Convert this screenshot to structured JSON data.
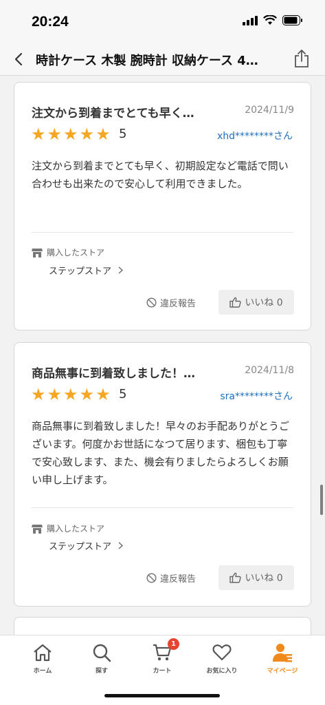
{
  "status": {
    "time": "20:24"
  },
  "nav": {
    "title": "時計ケース 木製 腕時計 収納ケース 4…"
  },
  "reviews": [
    {
      "title": "注文から到着までとても早く…",
      "date": "2024/11/9",
      "rating": "5",
      "stars": 5,
      "reviewer": "xhd********さん",
      "body": "注文から到着までとても早く、初期設定など電話で問い合わせも出来たので安心して利用できました。",
      "store_label": "購入したストア",
      "store_name": "ステップストア",
      "report_label": "違反報告",
      "like_label": "いいね 0"
    },
    {
      "title": "商品無事に到着致しました！…",
      "date": "2024/11/8",
      "rating": "5",
      "stars": 5,
      "reviewer": "sra********さん",
      "body": "商品無事に到着致しました！早々のお手配ありがとうございます。何度かお世話になつて居ります、梱包も丁寧で安心致します、また、機会有りましたらよろしくお願い申し上げます。",
      "store_label": "購入したストア",
      "store_name": "ステップストア",
      "report_label": "違反報告",
      "like_label": "いいね 0"
    }
  ],
  "tabs": [
    {
      "label": "ホーム",
      "icon": "home-icon"
    },
    {
      "label": "探す",
      "icon": "search-icon"
    },
    {
      "label": "カート",
      "icon": "cart-icon",
      "badge": "1"
    },
    {
      "label": "お気に入り",
      "icon": "heart-icon"
    },
    {
      "label": "マイページ",
      "icon": "user-icon",
      "active": true
    }
  ],
  "colors": {
    "accent": "#f08a1c",
    "star": "#f5a623",
    "link": "#1f6fc1",
    "badge": "#e8432e"
  }
}
